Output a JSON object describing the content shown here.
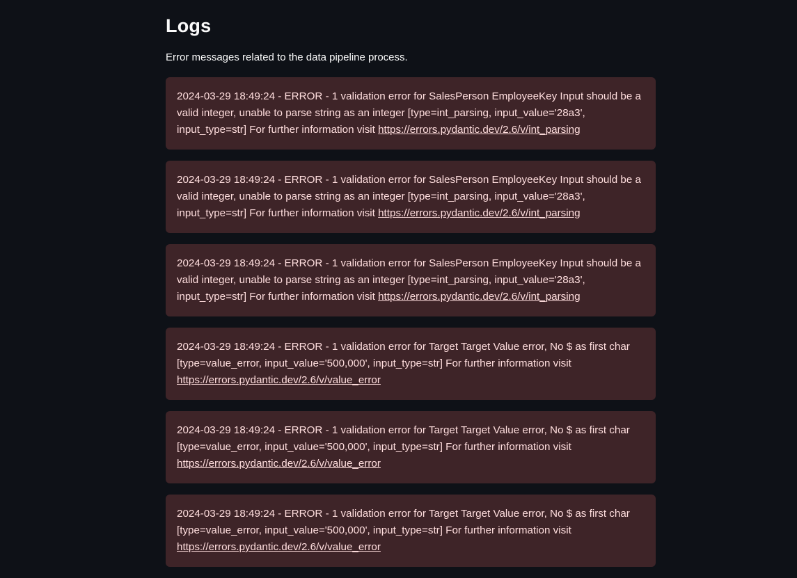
{
  "header": {
    "title": "Logs",
    "subtitle": "Error messages related to the data pipeline process."
  },
  "logs": [
    {
      "message": "2024-03-29 18:49:24 - ERROR - 1 validation error for SalesPerson EmployeeKey Input should be a valid integer, unable to parse string as an integer [type=int_parsing, input_value='28a3', input_type=str] For further information visit ",
      "link": "https://errors.pydantic.dev/2.6/v/int_parsing"
    },
    {
      "message": "2024-03-29 18:49:24 - ERROR - 1 validation error for SalesPerson EmployeeKey Input should be a valid integer, unable to parse string as an integer [type=int_parsing, input_value='28a3', input_type=str] For further information visit ",
      "link": "https://errors.pydantic.dev/2.6/v/int_parsing"
    },
    {
      "message": "2024-03-29 18:49:24 - ERROR - 1 validation error for SalesPerson EmployeeKey Input should be a valid integer, unable to parse string as an integer [type=int_parsing, input_value='28a3', input_type=str] For further information visit ",
      "link": "https://errors.pydantic.dev/2.6/v/int_parsing"
    },
    {
      "message": "2024-03-29 18:49:24 - ERROR - 1 validation error for Target Target Value error, No $ as first char [type=value_error, input_value='500,000', input_type=str] For further information visit ",
      "link": "https://errors.pydantic.dev/2.6/v/value_error"
    },
    {
      "message": "2024-03-29 18:49:24 - ERROR - 1 validation error for Target Target Value error, No $ as first char [type=value_error, input_value='500,000', input_type=str] For further information visit ",
      "link": "https://errors.pydantic.dev/2.6/v/value_error"
    },
    {
      "message": "2024-03-29 18:49:24 - ERROR - 1 validation error for Target Target Value error, No $ as first char [type=value_error, input_value='500,000', input_type=str] For further information visit ",
      "link": "https://errors.pydantic.dev/2.6/v/value_error"
    }
  ],
  "colors": {
    "background": "#0e1117",
    "error_box": "#3e2428",
    "error_text": "#ffdede"
  }
}
